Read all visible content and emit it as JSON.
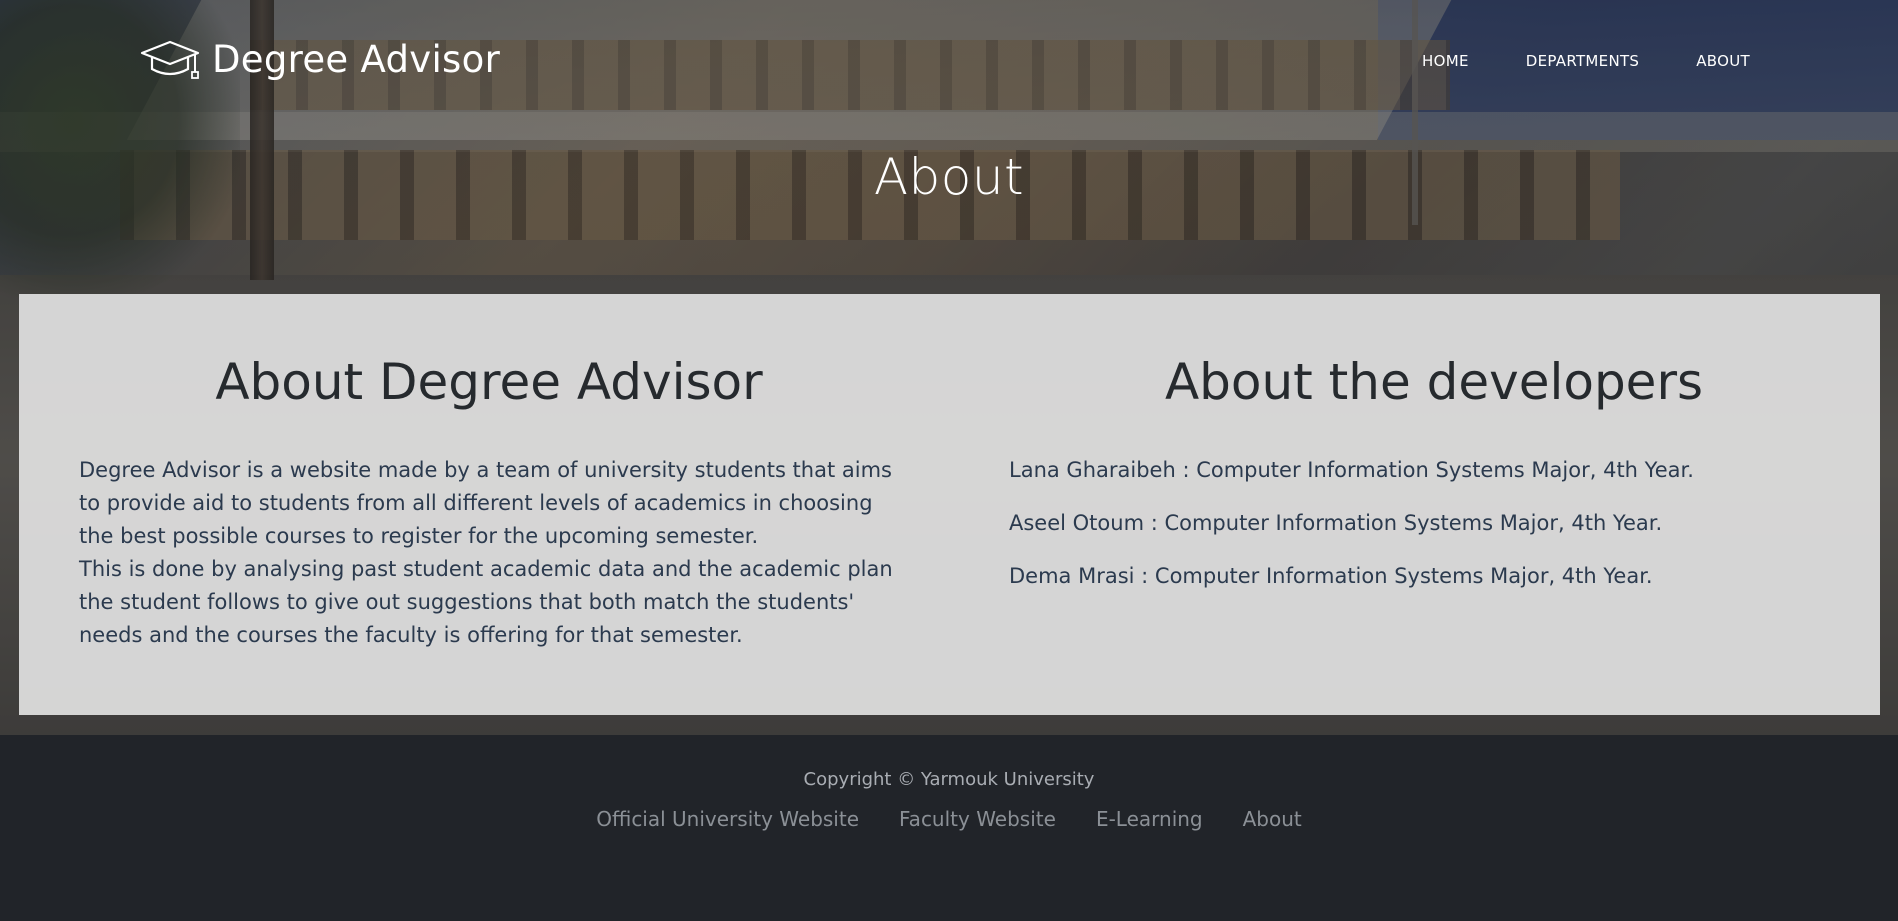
{
  "header": {
    "brand_name": "Degree Advisor",
    "brand_icon": "graduation-cap-icon",
    "nav": [
      {
        "label": "HOME"
      },
      {
        "label": "DEPARTMENTS"
      },
      {
        "label": "ABOUT"
      }
    ],
    "page_title": "About"
  },
  "main": {
    "about_app": {
      "title": "About Degree Advisor",
      "paragraphs": [
        "Degree Advisor is a website made by a team of university students that aims to provide aid to students from all different levels of academics in choosing the best possible courses to register for the upcoming semester.",
        "This is done by analysing past student academic data and the academic plan the student follows to give out suggestions that both match the students' needs and the courses the faculty is offering for that semester."
      ]
    },
    "about_developers": {
      "title": "About the developers",
      "developers": [
        "Lana Gharaibeh : Computer Information Systems Major, 4th Year.",
        "Aseel Otoum : Computer Information Systems Major, 4th Year.",
        "Dema Mrasi : Computer Information Systems Major, 4th Year."
      ]
    }
  },
  "footer": {
    "copyright": "Copyright © Yarmouk University",
    "links": [
      {
        "label": "Official University Website"
      },
      {
        "label": "Faculty Website"
      },
      {
        "label": "E-Learning"
      },
      {
        "label": "About"
      }
    ]
  },
  "colors": {
    "footer_bg": "#212429",
    "panel_bg": "#e2e2e2",
    "heading_text": "#262a2e",
    "body_text": "#2b3a4e",
    "footer_link": "#8b9096"
  }
}
